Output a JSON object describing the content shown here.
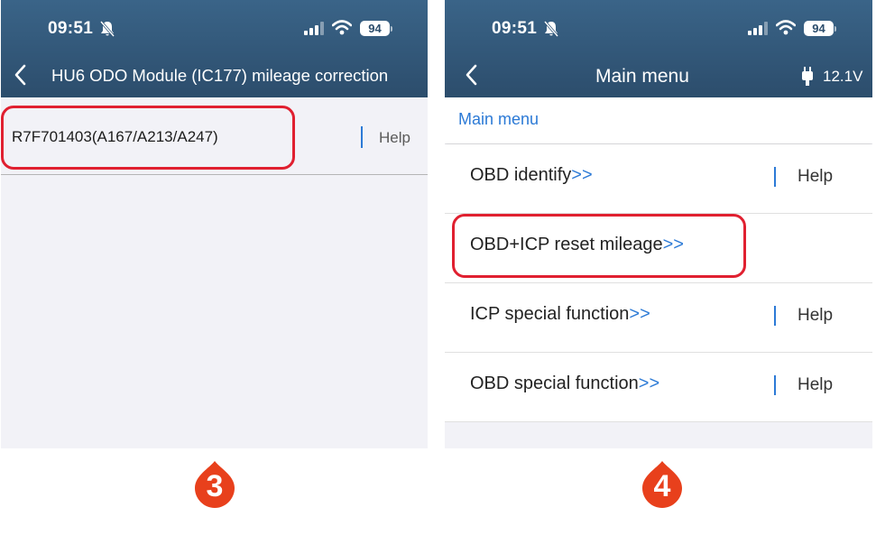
{
  "left_screen": {
    "status": {
      "time": "09:51",
      "battery": "94"
    },
    "nav": {
      "title": "HU6 ODO Module (IC177) mileage correction"
    },
    "rows": [
      {
        "label": "R7F701403(A167/A213/A247)",
        "help": "Help"
      }
    ],
    "step": "3"
  },
  "right_screen": {
    "status": {
      "time": "09:51",
      "battery": "94"
    },
    "nav": {
      "title": "Main menu",
      "voltage": "12.1V"
    },
    "breadcrumb": "Main menu",
    "items": [
      {
        "label": "OBD identify",
        "arrows": ">>",
        "help": "Help"
      },
      {
        "label": "OBD+ICP reset mileage",
        "arrows": ">>",
        "help": ""
      },
      {
        "label": "ICP special function",
        "arrows": ">>",
        "help": "Help"
      },
      {
        "label": "OBD special function",
        "arrows": ">>",
        "help": "Help"
      }
    ],
    "step": "4"
  },
  "colors": {
    "header": "#2c4d6c",
    "accent": "#2c7ad6",
    "highlight": "#e02030",
    "badge": "#e8401c"
  }
}
